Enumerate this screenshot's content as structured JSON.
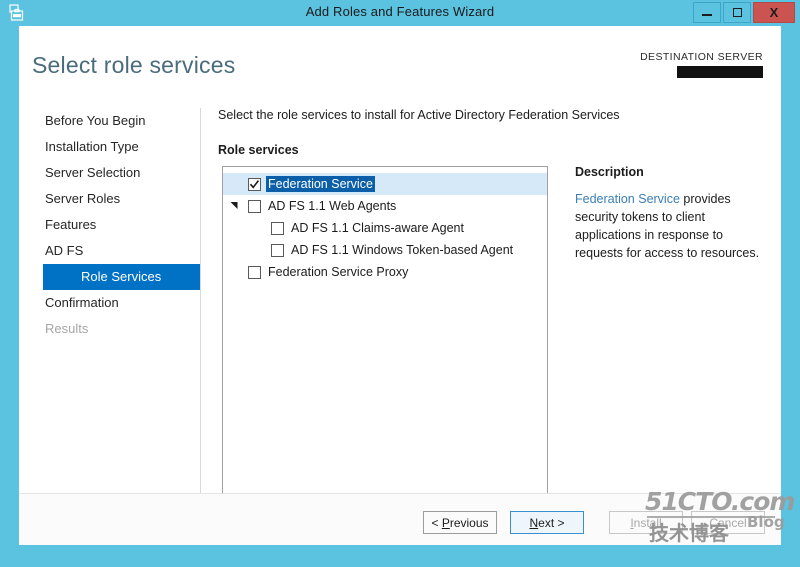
{
  "window": {
    "title": "Add Roles and Features Wizard",
    "icon": "server-toolbox-icon",
    "accent_color": "#5bc2e0",
    "controls": {
      "minimize": "–",
      "maximize": "□",
      "close": "X"
    }
  },
  "header": {
    "page_title": "Select role services",
    "destination_label": "DESTINATION SERVER",
    "destination_value": ""
  },
  "sidebar": {
    "items": [
      {
        "label": "Before You Begin",
        "state": "normal"
      },
      {
        "label": "Installation Type",
        "state": "normal"
      },
      {
        "label": "Server Selection",
        "state": "normal"
      },
      {
        "label": "Server Roles",
        "state": "normal"
      },
      {
        "label": "Features",
        "state": "normal"
      },
      {
        "label": "AD FS",
        "state": "normal"
      },
      {
        "label": "Role Services",
        "state": "selected"
      },
      {
        "label": "Confirmation",
        "state": "normal"
      },
      {
        "label": "Results",
        "state": "disabled"
      }
    ],
    "selected_color": "#0072c6"
  },
  "main": {
    "instruction": "Select the role services to install for Active Directory Federation Services",
    "section_label": "Role services",
    "tree": [
      {
        "label": "Federation Service",
        "checked": true,
        "selected": true,
        "level": 0,
        "expander": "none"
      },
      {
        "label": "AD FS 1.1 Web Agents",
        "checked": false,
        "selected": false,
        "level": 1,
        "expander": "expanded"
      },
      {
        "label": "AD FS 1.1 Claims-aware Agent",
        "checked": false,
        "selected": false,
        "level": 2,
        "expander": "none"
      },
      {
        "label": "AD FS 1.1 Windows Token-based Agent",
        "checked": false,
        "selected": false,
        "level": 2,
        "expander": "none"
      },
      {
        "label": "Federation Service Proxy",
        "checked": false,
        "selected": false,
        "level": 1,
        "expander": "none"
      }
    ]
  },
  "description": {
    "title": "Description",
    "link_text": "Federation Service",
    "body_text": " provides security tokens to client applications in response to requests for access to resources."
  },
  "footer": {
    "previous": {
      "label": "< Previous",
      "accel": "P",
      "state": "enabled"
    },
    "next": {
      "label": "Next >",
      "accel": "N",
      "state": "focused"
    },
    "install": {
      "label": "Install",
      "accel": "I",
      "state": "disabled"
    },
    "cancel": {
      "label": "Cancel",
      "accel": "C",
      "state": "disabled"
    }
  },
  "watermark": {
    "top": "51CTO.com",
    "chinese": "技术博客",
    "blog": "Blog"
  }
}
